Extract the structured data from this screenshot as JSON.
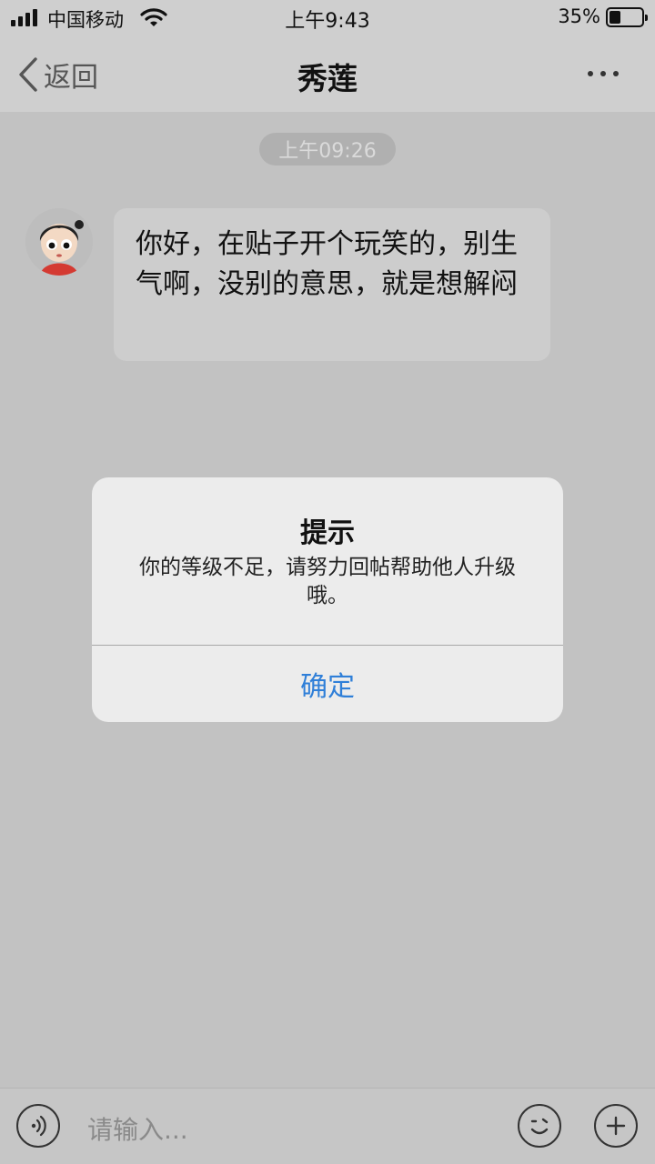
{
  "status_bar": {
    "carrier": "中国移动",
    "time": "上午9:43",
    "battery_percent_label": "35%",
    "battery_level": 0.35
  },
  "nav": {
    "back_label": "返回",
    "title": "秀莲"
  },
  "chat": {
    "timestamp": "上午09:26",
    "messages": [
      {
        "text": "你好，在贴子开个玩笑的，别生气啊，没别的意思，就是想解闷"
      }
    ]
  },
  "dialog": {
    "title": "提示",
    "message": "你的等级不足，请努力回帖帮助他人升级哦。",
    "confirm_label": "确定",
    "confirm_color": "#2f7fd8"
  },
  "input_bar": {
    "placeholder": "请输入..."
  }
}
